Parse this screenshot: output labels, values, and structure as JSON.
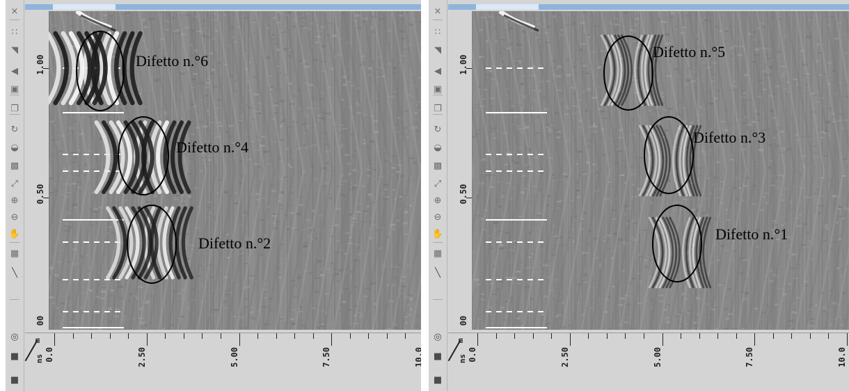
{
  "y_axis": {
    "ticks": [
      "1.00",
      "0.50",
      "00"
    ]
  },
  "x_axis": {
    "unit_top": "m",
    "unit_bottom": "ns",
    "ticks": [
      "0.0",
      "2.50",
      "5.00",
      "7.50",
      "10.0"
    ]
  },
  "panels": [
    {
      "annotations": [
        "Difetto n.°6",
        "Difetto n.°4",
        "Difetto n.°2"
      ]
    },
    {
      "annotations": [
        "Difetto n.°5",
        "Difetto n.°3",
        "Difetto n.°1"
      ]
    }
  ],
  "toolbar": {
    "icons": [
      "close-icon",
      "grid-dots-icon",
      "arrow-icon",
      "speaker-icon",
      "screen-icon",
      "copy-icon",
      "rotate-icon",
      "mouse-icon",
      "zoom-fit-icon",
      "expand-icon",
      "zoom-in-icon",
      "zoom-out-icon",
      "pan-icon",
      "grid-icon",
      "curve-icon",
      "record-icon",
      "stop-icon",
      "square-icon"
    ]
  },
  "colors": {
    "background": "#d4d4d4",
    "plot": "#8e8e8e",
    "title_bar": "#8fb4dc",
    "ellipse": "#000000"
  }
}
